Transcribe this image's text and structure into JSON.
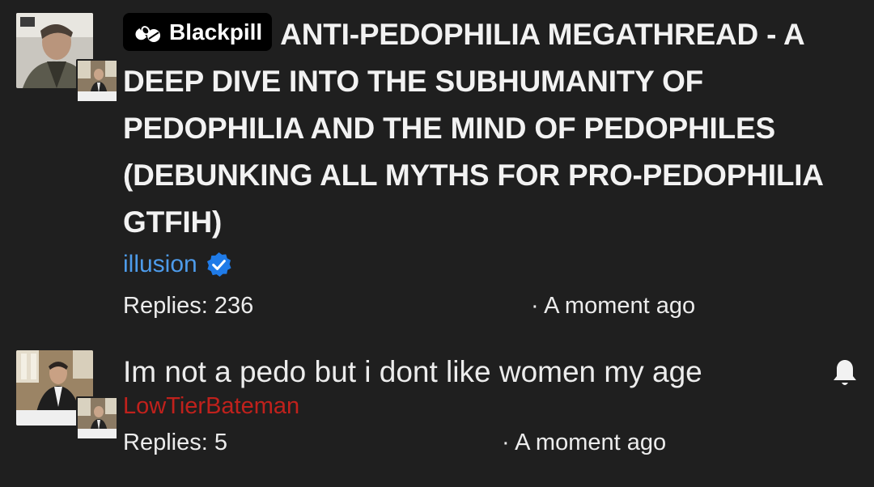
{
  "threads": [
    {
      "badge_label": "Blackpill",
      "title": "ANTI-PEDOPHILIA MEGATHREAD - A DEEP DIVE INTO THE SUBHUMANITY OF PEDOPHILIA AND THE MIND OF PEDOPHILES (DEBUNKING ALL MYTHS FOR PRO-PEDOPHILIA GTFIH)",
      "author": "illusion",
      "author_color": "#4d9bea",
      "verified": true,
      "replies_label": "Replies: 236",
      "time_label": "· A moment ago"
    },
    {
      "body": "Im not a pedo but i dont like women my age",
      "author": "LowTierBateman",
      "author_color": "#c0211c",
      "replies_label": "Replies: 5",
      "time_label": "· A moment ago",
      "icon": "bell-icon"
    }
  ]
}
